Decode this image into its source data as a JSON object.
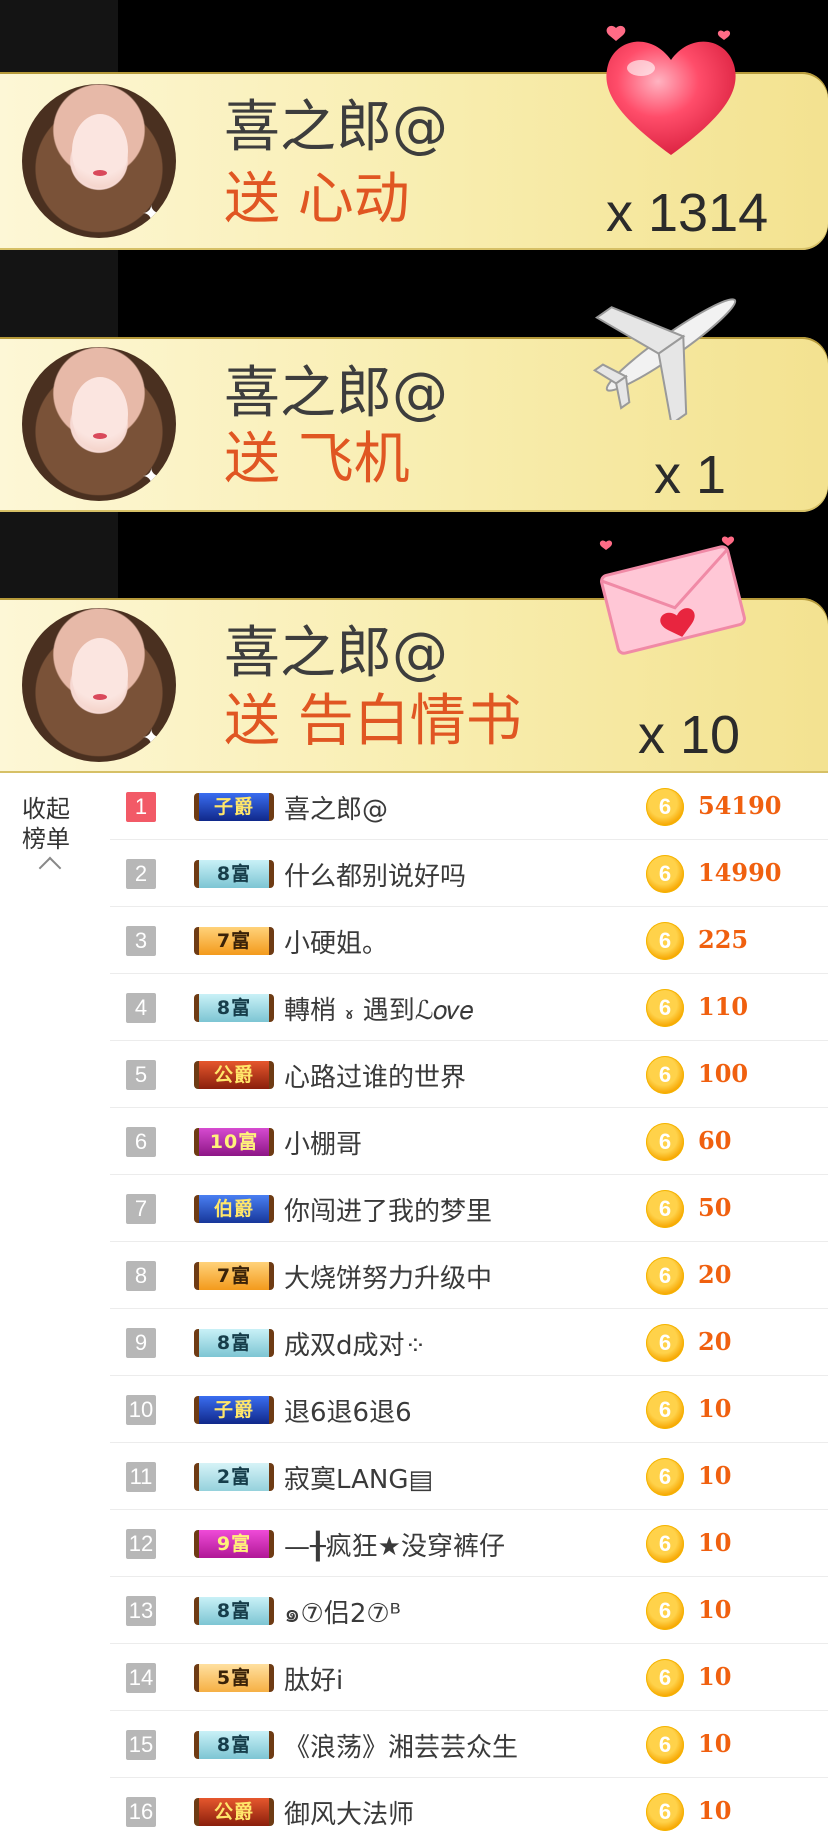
{
  "gifts": [
    {
      "sender": "喜之郎@",
      "action": "送 心动",
      "count": "x 1314",
      "icon": "heart-icon"
    },
    {
      "sender": "喜之郎@",
      "action": "送 飞机",
      "count": "x 1",
      "icon": "airplane-icon"
    },
    {
      "sender": "喜之郎@",
      "action": "送 告白情书",
      "count": "x 10",
      "icon": "love-letter-icon"
    }
  ],
  "collapse": {
    "line1": "收起",
    "line2": "榜单"
  },
  "ranking": [
    {
      "rank": "1",
      "badge": "子爵",
      "name": "喜之郎@",
      "score": "54190"
    },
    {
      "rank": "2",
      "badge": "8富",
      "name": "什么都别说好吗",
      "score": "14990"
    },
    {
      "rank": "3",
      "badge": "7富",
      "name": "小硬姐。",
      "score": "225"
    },
    {
      "rank": "4",
      "badge": "8富",
      "name": "轉梢 ៵ 遇到ℒ𝑜𝑣𝑒",
      "score": "110"
    },
    {
      "rank": "5",
      "badge": "公爵",
      "name": "心路过谁的世界",
      "score": "100"
    },
    {
      "rank": "6",
      "badge": "10富",
      "name": "小棚哥",
      "score": "60"
    },
    {
      "rank": "7",
      "badge": "伯爵",
      "name": "你闯进了我的梦里",
      "score": "50"
    },
    {
      "rank": "8",
      "badge": "7富",
      "name": "大烧饼努力升级中",
      "score": "20"
    },
    {
      "rank": "9",
      "badge": "8富",
      "name": "成双d成对⁘",
      "score": "20"
    },
    {
      "rank": "10",
      "badge": "子爵",
      "name": "退6退6退6",
      "score": "10"
    },
    {
      "rank": "11",
      "badge": "2富",
      "name": "寂寞LANG▤",
      "score": "10"
    },
    {
      "rank": "12",
      "badge": "9富",
      "name": "—╂疯狂★没穿裤仔",
      "score": "10"
    },
    {
      "rank": "13",
      "badge": "8富",
      "name": "๑⑦侣2⑦ᴮ",
      "score": "10"
    },
    {
      "rank": "14",
      "badge": "5富",
      "name": "肽好i",
      "score": "10"
    },
    {
      "rank": "15",
      "badge": "8富",
      "name": "《浪荡》湘芸芸众生",
      "score": "10"
    },
    {
      "rank": "16",
      "badge": "公爵",
      "name": "御风大法师",
      "score": "10"
    }
  ],
  "coin_symbol": "6",
  "colors": {
    "first_rank": "#f25a67",
    "other_rank": "#b7b7b7",
    "score": "#f0600f",
    "gift_action": "#e05622",
    "badge_子爵": "#1c3fa8",
    "badge_富_light": "#8fd3e0",
    "badge_7富": "#f7a934",
    "badge_公爵": "#c23a1e",
    "badge_10富": "#b22aa8",
    "badge_伯爵": "#2454b8",
    "badge_9富": "#d42fb3",
    "badge_5富": "#f2b24a"
  }
}
